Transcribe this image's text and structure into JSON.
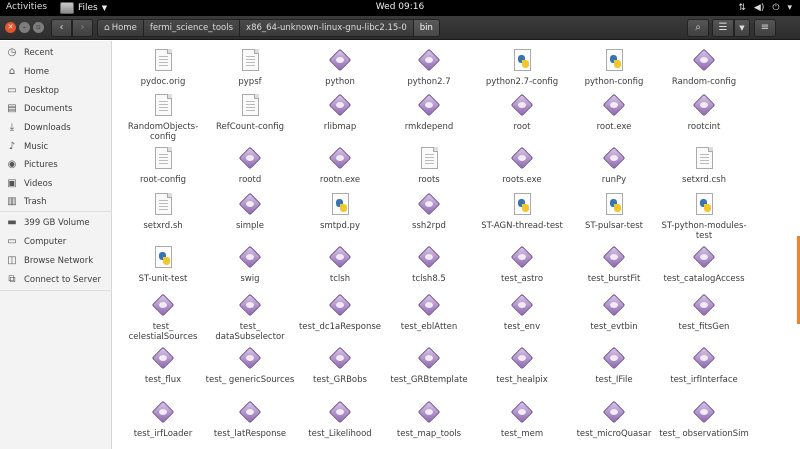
{
  "topbar": {
    "activities": "Activities",
    "app_name": "Files",
    "clock": "Wed 09:16"
  },
  "header": {
    "home_label": "Home",
    "path": [
      "fermi_science_tools",
      "x86_64-unknown-linux-gnu-libc2.15-0",
      "bin"
    ]
  },
  "sidebar": {
    "items": [
      {
        "label": "Recent",
        "icon": "clock-icon"
      },
      {
        "label": "Home",
        "icon": "home-icon"
      },
      {
        "label": "Desktop",
        "icon": "folder-icon"
      },
      {
        "label": "Documents",
        "icon": "document-icon"
      },
      {
        "label": "Downloads",
        "icon": "download-icon"
      },
      {
        "label": "Music",
        "icon": "music-icon"
      },
      {
        "label": "Pictures",
        "icon": "camera-icon"
      },
      {
        "label": "Videos",
        "icon": "video-icon"
      },
      {
        "label": "Trash",
        "icon": "trash-icon"
      },
      {
        "label": "399 GB Volume",
        "icon": "drive-icon"
      },
      {
        "label": "Computer",
        "icon": "computer-icon"
      },
      {
        "label": "Browse Network",
        "icon": "network-icon"
      },
      {
        "label": "Connect to Server",
        "icon": "server-icon"
      }
    ]
  },
  "files": [
    {
      "name": "pydoc.orig",
      "type": "doc"
    },
    {
      "name": "pypsf",
      "type": "doc"
    },
    {
      "name": "python",
      "type": "exec"
    },
    {
      "name": "python2.7",
      "type": "exec"
    },
    {
      "name": "python2.7-config",
      "type": "py"
    },
    {
      "name": "python-config",
      "type": "py"
    },
    {
      "name": "Random-config",
      "type": "exec"
    },
    {
      "name": "RandomObjects-config",
      "type": "doc"
    },
    {
      "name": "RefCount-config",
      "type": "doc"
    },
    {
      "name": "rlibmap",
      "type": "exec"
    },
    {
      "name": "rmkdepend",
      "type": "exec"
    },
    {
      "name": "root",
      "type": "exec"
    },
    {
      "name": "root.exe",
      "type": "exec"
    },
    {
      "name": "rootcint",
      "type": "exec"
    },
    {
      "name": "root-config",
      "type": "doc"
    },
    {
      "name": "rootd",
      "type": "exec"
    },
    {
      "name": "rootn.exe",
      "type": "exec"
    },
    {
      "name": "roots",
      "type": "doc"
    },
    {
      "name": "roots.exe",
      "type": "exec"
    },
    {
      "name": "runPy",
      "type": "exec"
    },
    {
      "name": "setxrd.csh",
      "type": "doc"
    },
    {
      "name": "setxrd.sh",
      "type": "doc"
    },
    {
      "name": "simple",
      "type": "exec"
    },
    {
      "name": "smtpd.py",
      "type": "py"
    },
    {
      "name": "ssh2rpd",
      "type": "exec"
    },
    {
      "name": "ST-AGN-thread-test",
      "type": "py"
    },
    {
      "name": "ST-pulsar-test",
      "type": "py"
    },
    {
      "name": "ST-python-modules-test",
      "type": "py"
    },
    {
      "name": "ST-unit-test",
      "type": "py"
    },
    {
      "name": "swig",
      "type": "exec"
    },
    {
      "name": "tclsh",
      "type": "exec"
    },
    {
      "name": "tclsh8.5",
      "type": "exec"
    },
    {
      "name": "test_astro",
      "type": "exec"
    },
    {
      "name": "test_burstFit",
      "type": "exec"
    },
    {
      "name": "test_catalogAccess",
      "type": "exec"
    },
    {
      "name": "test_ celestialSources",
      "type": "exec"
    },
    {
      "name": "test_ dataSubselector",
      "type": "exec"
    },
    {
      "name": "test_dc1aResponse",
      "type": "exec"
    },
    {
      "name": "test_eblAtten",
      "type": "exec"
    },
    {
      "name": "test_env",
      "type": "exec"
    },
    {
      "name": "test_evtbin",
      "type": "exec"
    },
    {
      "name": "test_fitsGen",
      "type": "exec"
    },
    {
      "name": "test_flux",
      "type": "exec"
    },
    {
      "name": "test_ genericSources",
      "type": "exec"
    },
    {
      "name": "test_GRBobs",
      "type": "exec"
    },
    {
      "name": "test_GRBtemplate",
      "type": "exec"
    },
    {
      "name": "test_healpix",
      "type": "exec"
    },
    {
      "name": "test_IFile",
      "type": "exec"
    },
    {
      "name": "test_irfInterface",
      "type": "exec"
    },
    {
      "name": "test_irfLoader",
      "type": "exec"
    },
    {
      "name": "test_latResponse",
      "type": "exec"
    },
    {
      "name": "test_Likelihood",
      "type": "exec"
    },
    {
      "name": "test_map_tools",
      "type": "exec"
    },
    {
      "name": "test_mem",
      "type": "exec"
    },
    {
      "name": "test_microQuasar",
      "type": "exec"
    },
    {
      "name": "test_ observationSim",
      "type": "exec"
    }
  ],
  "colors": {
    "accent": "#f0822d",
    "topbar": "#000000",
    "headerbar": "#333333",
    "exec_icon": "#8f6bb0",
    "close_button": "#e4542d"
  }
}
